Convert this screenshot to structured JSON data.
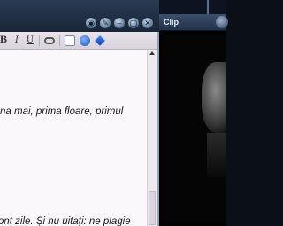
{
  "window": {
    "controls": [
      {
        "name": "camera-icon",
        "glyph": "◉"
      },
      {
        "name": "wrench-icon",
        "glyph": "✎"
      },
      {
        "name": "minimize-icon",
        "glyph": "–"
      },
      {
        "name": "restore-icon",
        "glyph": "▢"
      },
      {
        "name": "close-icon",
        "glyph": "✕"
      }
    ]
  },
  "clip": {
    "title": "Clip"
  },
  "toolbar": {
    "bold_label": "B",
    "italic_label": "I",
    "underline_label": "U"
  },
  "editor": {
    "line1": "na mai, prima floare, primul",
    "line2": "ont zile. Și nu uitați: ne plagie"
  }
}
